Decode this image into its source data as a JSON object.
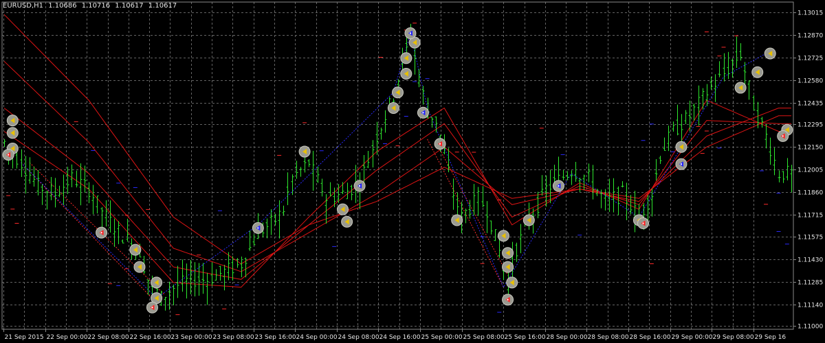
{
  "header": {
    "symbol": "EURUSD,H1",
    "open": "1.10686",
    "high": "1.10716",
    "low": "1.10617",
    "close": "1.10617"
  },
  "colors": {
    "background": "#000000",
    "grid": "#646464",
    "candle": "#2ee82e",
    "ma": "#dd1414",
    "zigzag_blue": "#2a2aff",
    "dotted_red": "#ff2a2a",
    "text": "#e6e6e6"
  },
  "chart_data": {
    "type": "candlestick",
    "symbol": "EURUSD",
    "timeframe": "H1",
    "ylim": [
      1.1098,
      1.1308
    ],
    "y_ticks": [
      "1.13015",
      "1.12870",
      "1.12725",
      "1.12580",
      "1.12435",
      "1.12295",
      "1.12150",
      "1.12005",
      "1.11860",
      "1.11715",
      "1.11575",
      "1.11430",
      "1.11285",
      "1.11140",
      "1.11000"
    ],
    "x_ticks": [
      "21 Sep 2015",
      "22 Sep 00:00",
      "22 Sep 08:00",
      "22 Sep 16:00",
      "23 Sep 00:00",
      "23 Sep 08:00",
      "23 Sep 16:00",
      "24 Sep 00:00",
      "24 Sep 08:00",
      "24 Sep 16:00",
      "25 Sep 00:00",
      "25 Sep 08:00",
      "25 Sep 16:00",
      "28 Sep 00:00",
      "28 Sep 08:00",
      "28 Sep 16:00",
      "29 Sep 00:00",
      "29 Sep 08:00",
      "29 Sep 16"
    ],
    "grid": true,
    "price_path": [
      [
        0,
        1.1218
      ],
      [
        4,
        1.1205
      ],
      [
        8,
        1.119
      ],
      [
        12,
        1.1185
      ],
      [
        16,
        1.1195
      ],
      [
        20,
        1.1188
      ],
      [
        24,
        1.117
      ],
      [
        28,
        1.1158
      ],
      [
        32,
        1.1148
      ],
      [
        34,
        1.113
      ],
      [
        37,
        1.1118
      ],
      [
        40,
        1.1125
      ],
      [
        44,
        1.113
      ],
      [
        48,
        1.113
      ],
      [
        52,
        1.1135
      ],
      [
        56,
        1.114
      ],
      [
        60,
        1.116
      ],
      [
        64,
        1.1168
      ],
      [
        66,
        1.1175
      ],
      [
        68,
        1.1195
      ],
      [
        72,
        1.1205
      ],
      [
        76,
        1.1182
      ],
      [
        80,
        1.1185
      ],
      [
        84,
        1.1192
      ],
      [
        88,
        1.1222
      ],
      [
        92,
        1.1248
      ],
      [
        94,
        1.127
      ],
      [
        96,
        1.1285
      ],
      [
        98,
        1.126
      ],
      [
        100,
        1.1238
      ],
      [
        102,
        1.1232
      ],
      [
        104,
        1.1212
      ],
      [
        106,
        1.1185
      ],
      [
        108,
        1.117
      ],
      [
        112,
        1.1182
      ],
      [
        114,
        1.1175
      ],
      [
        117,
        1.1148
      ],
      [
        119,
        1.1128
      ],
      [
        121,
        1.115
      ],
      [
        124,
        1.1168
      ],
      [
        128,
        1.1188
      ],
      [
        130,
        1.1192
      ],
      [
        134,
        1.12
      ],
      [
        138,
        1.1195
      ],
      [
        142,
        1.118
      ],
      [
        146,
        1.1185
      ],
      [
        150,
        1.117
      ],
      [
        153,
        1.1185
      ],
      [
        155,
        1.121
      ],
      [
        158,
        1.1225
      ],
      [
        162,
        1.1235
      ],
      [
        166,
        1.125
      ],
      [
        170,
        1.1262
      ],
      [
        174,
        1.1275
      ],
      [
        177,
        1.1242
      ],
      [
        180,
        1.1222
      ],
      [
        183,
        1.1198
      ]
    ],
    "moving_averages": [
      {
        "values": [
          [
            0,
            1.13
          ],
          [
            20,
            1.1245
          ],
          [
            40,
            1.117
          ],
          [
            56,
            1.114
          ],
          [
            72,
            1.1165
          ],
          [
            88,
            1.118
          ],
          [
            104,
            1.1202
          ],
          [
            120,
            1.1182
          ],
          [
            136,
            1.1188
          ],
          [
            150,
            1.1182
          ],
          [
            166,
            1.1215
          ],
          [
            183,
            1.1235
          ]
        ]
      },
      {
        "values": [
          [
            0,
            1.127
          ],
          [
            20,
            1.1218
          ],
          [
            40,
            1.115
          ],
          [
            56,
            1.1135
          ],
          [
            72,
            1.116
          ],
          [
            88,
            1.1185
          ],
          [
            104,
            1.1215
          ],
          [
            120,
            1.1178
          ],
          [
            136,
            1.1188
          ],
          [
            150,
            1.118
          ],
          [
            166,
            1.1222
          ],
          [
            183,
            1.124
          ]
        ]
      },
      {
        "values": [
          [
            0,
            1.124
          ],
          [
            20,
            1.1198
          ],
          [
            40,
            1.1138
          ],
          [
            56,
            1.113
          ],
          [
            72,
            1.1165
          ],
          [
            88,
            1.12
          ],
          [
            104,
            1.123
          ],
          [
            120,
            1.117
          ],
          [
            136,
            1.119
          ],
          [
            150,
            1.1178
          ],
          [
            166,
            1.1232
          ],
          [
            183,
            1.123
          ]
        ]
      },
      {
        "values": [
          [
            0,
            1.1225
          ],
          [
            20,
            1.1188
          ],
          [
            40,
            1.1128
          ],
          [
            56,
            1.1125
          ],
          [
            72,
            1.117
          ],
          [
            88,
            1.1212
          ],
          [
            104,
            1.124
          ],
          [
            120,
            1.1165
          ],
          [
            136,
            1.1192
          ],
          [
            150,
            1.1175
          ],
          [
            166,
            1.1245
          ],
          [
            183,
            1.1225
          ]
        ]
      }
    ],
    "zigzag": [
      [
        4,
        1.1205
      ],
      [
        36,
        1.1118
      ],
      [
        60,
        1.1165
      ],
      [
        92,
        1.125
      ],
      [
        96,
        1.1288
      ],
      [
        100,
        1.124
      ],
      [
        118,
        1.1125
      ],
      [
        134,
        1.1198
      ],
      [
        150,
        1.117
      ],
      [
        170,
        1.126
      ],
      [
        180,
        1.1275
      ]
    ],
    "dotted_lines": [
      [
        [
          4,
          1.1205
        ],
        [
          36,
          1.1115
        ]
      ],
      [
        [
          6,
          1.1205
        ],
        [
          38,
          1.112
        ]
      ],
      [
        [
          100,
          1.122
        ],
        [
          118,
          1.1125
        ]
      ],
      [
        [
          102,
          1.1218
        ],
        [
          120,
          1.1128
        ]
      ]
    ],
    "markers": [
      {
        "x": 2,
        "y": 1.1232,
        "type": "sell"
      },
      {
        "x": 2,
        "y": 1.1224,
        "type": "sell"
      },
      {
        "x": 2,
        "y": 1.1214,
        "type": "sell"
      },
      {
        "x": 1,
        "y": 1.121,
        "type": "buy"
      },
      {
        "x": 23,
        "y": 1.116,
        "type": "buy"
      },
      {
        "x": 31,
        "y": 1.1149,
        "type": "sell"
      },
      {
        "x": 32,
        "y": 1.1138,
        "type": "sell"
      },
      {
        "x": 36,
        "y": 1.1128,
        "type": "sell"
      },
      {
        "x": 36,
        "y": 1.1118,
        "type": "sell"
      },
      {
        "x": 35,
        "y": 1.1112,
        "type": "buy"
      },
      {
        "x": 60,
        "y": 1.1163,
        "type": "exit"
      },
      {
        "x": 71,
        "y": 1.1212,
        "type": "sell"
      },
      {
        "x": 80,
        "y": 1.1175,
        "type": "sell"
      },
      {
        "x": 81,
        "y": 1.1167,
        "type": "sell"
      },
      {
        "x": 84,
        "y": 1.119,
        "type": "exit"
      },
      {
        "x": 92,
        "y": 1.124,
        "type": "sell"
      },
      {
        "x": 93,
        "y": 1.125,
        "type": "sell"
      },
      {
        "x": 95,
        "y": 1.1262,
        "type": "sell"
      },
      {
        "x": 95,
        "y": 1.1272,
        "type": "sell"
      },
      {
        "x": 97,
        "y": 1.1282,
        "type": "sell"
      },
      {
        "x": 96,
        "y": 1.1288,
        "type": "exit"
      },
      {
        "x": 99,
        "y": 1.1237,
        "type": "exit"
      },
      {
        "x": 103,
        "y": 1.1217,
        "type": "buy"
      },
      {
        "x": 107,
        "y": 1.1168,
        "type": "sell"
      },
      {
        "x": 118,
        "y": 1.1158,
        "type": "sell"
      },
      {
        "x": 119,
        "y": 1.1147,
        "type": "sell"
      },
      {
        "x": 119,
        "y": 1.1138,
        "type": "sell"
      },
      {
        "x": 120,
        "y": 1.1128,
        "type": "sell"
      },
      {
        "x": 119,
        "y": 1.1117,
        "type": "buy"
      },
      {
        "x": 124,
        "y": 1.1168,
        "type": "sell"
      },
      {
        "x": 131,
        "y": 1.119,
        "type": "exit"
      },
      {
        "x": 150,
        "y": 1.1168,
        "type": "sell"
      },
      {
        "x": 151,
        "y": 1.1166,
        "type": "buy"
      },
      {
        "x": 160,
        "y": 1.1215,
        "type": "sell"
      },
      {
        "x": 160,
        "y": 1.1204,
        "type": "exit"
      },
      {
        "x": 174,
        "y": 1.1253,
        "type": "sell"
      },
      {
        "x": 178,
        "y": 1.1263,
        "type": "sell"
      },
      {
        "x": 181,
        "y": 1.1275,
        "type": "sell"
      },
      {
        "x": 185,
        "y": 1.1226,
        "type": "sell"
      },
      {
        "x": 184,
        "y": 1.1222,
        "type": "buy"
      }
    ]
  }
}
